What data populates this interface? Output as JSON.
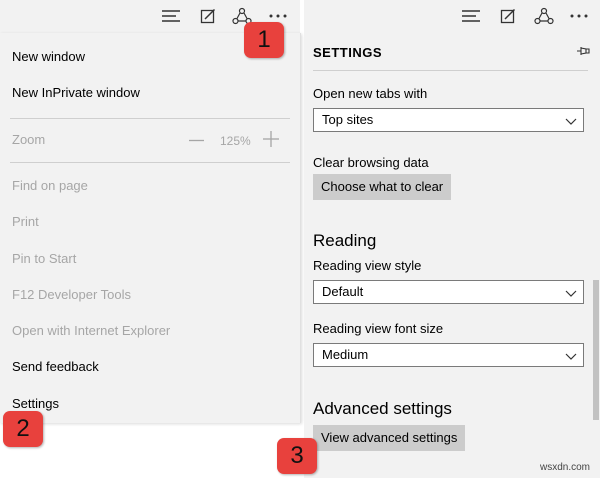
{
  "left_menu": {
    "items": [
      {
        "label": "New window",
        "enabled": true
      },
      {
        "label": "New InPrivate window",
        "enabled": true
      },
      {
        "label": "Find on page",
        "enabled": false
      },
      {
        "label": "Print",
        "enabled": false
      },
      {
        "label": "Pin to Start",
        "enabled": false
      },
      {
        "label": "F12 Developer Tools",
        "enabled": false
      },
      {
        "label": "Open with Internet Explorer",
        "enabled": false
      },
      {
        "label": "Send feedback",
        "enabled": true
      },
      {
        "label": "Settings",
        "enabled": true
      }
    ],
    "zoom": {
      "label": "Zoom",
      "value": "125%"
    }
  },
  "toolbar_icons": [
    "hub-icon",
    "web-note-icon",
    "share-icon",
    "more-icon"
  ],
  "badges": {
    "one": "1",
    "two": "2",
    "three": "3"
  },
  "settings": {
    "title": "SETTINGS",
    "open_new_tabs_label": "Open new tabs with",
    "open_new_tabs_value": "Top sites",
    "clear_browsing_label": "Clear browsing data",
    "clear_button": "Choose what to clear",
    "reading_heading": "Reading",
    "reading_view_style_label": "Reading view style",
    "reading_view_style_value": "Default",
    "reading_view_font_size_label": "Reading view font size",
    "reading_view_font_size_value": "Medium",
    "advanced_heading": "Advanced settings",
    "advanced_button": "View advanced settings"
  },
  "colors": {
    "badge": "#e8413d",
    "panel_bg": "#f2f2f2",
    "disabled_text": "#a6a6a6"
  },
  "watermark": "wsxdn.com"
}
